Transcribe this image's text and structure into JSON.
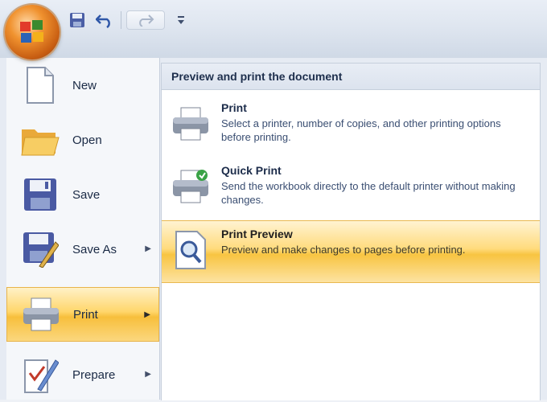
{
  "colors": {
    "accent_hover": "#f7bf3c",
    "menu_bg": "#f5f7fa",
    "header_bg": "#dce3ee",
    "title_text": "#1c2c4a"
  },
  "qat": {
    "icons": [
      "save-icon",
      "undo-icon",
      "redo-icon",
      "customize-qat-icon"
    ]
  },
  "left_menu": {
    "items": [
      {
        "label": "New",
        "icon": "new-document-icon",
        "has_submenu": false
      },
      {
        "label": "Open",
        "icon": "open-folder-icon",
        "has_submenu": false
      },
      {
        "label": "Save",
        "icon": "save-icon",
        "has_submenu": false
      },
      {
        "label": "Save As",
        "icon": "save-as-icon",
        "has_submenu": true
      },
      {
        "label": "Print",
        "icon": "printer-icon",
        "has_submenu": true,
        "active": true
      },
      {
        "label": "Prepare",
        "icon": "prepare-icon",
        "has_submenu": true
      }
    ]
  },
  "submenu": {
    "header": "Preview and print the document",
    "items": [
      {
        "title": "Print",
        "desc": "Select a printer, number of copies, and other printing options before printing.",
        "icon": "printer-icon"
      },
      {
        "title": "Quick Print",
        "desc": "Send the workbook directly to the default printer without making changes.",
        "icon": "quick-print-icon"
      },
      {
        "title": "Print Preview",
        "desc": "Preview and make changes to pages before printing.",
        "icon": "print-preview-icon",
        "active": true
      }
    ]
  }
}
